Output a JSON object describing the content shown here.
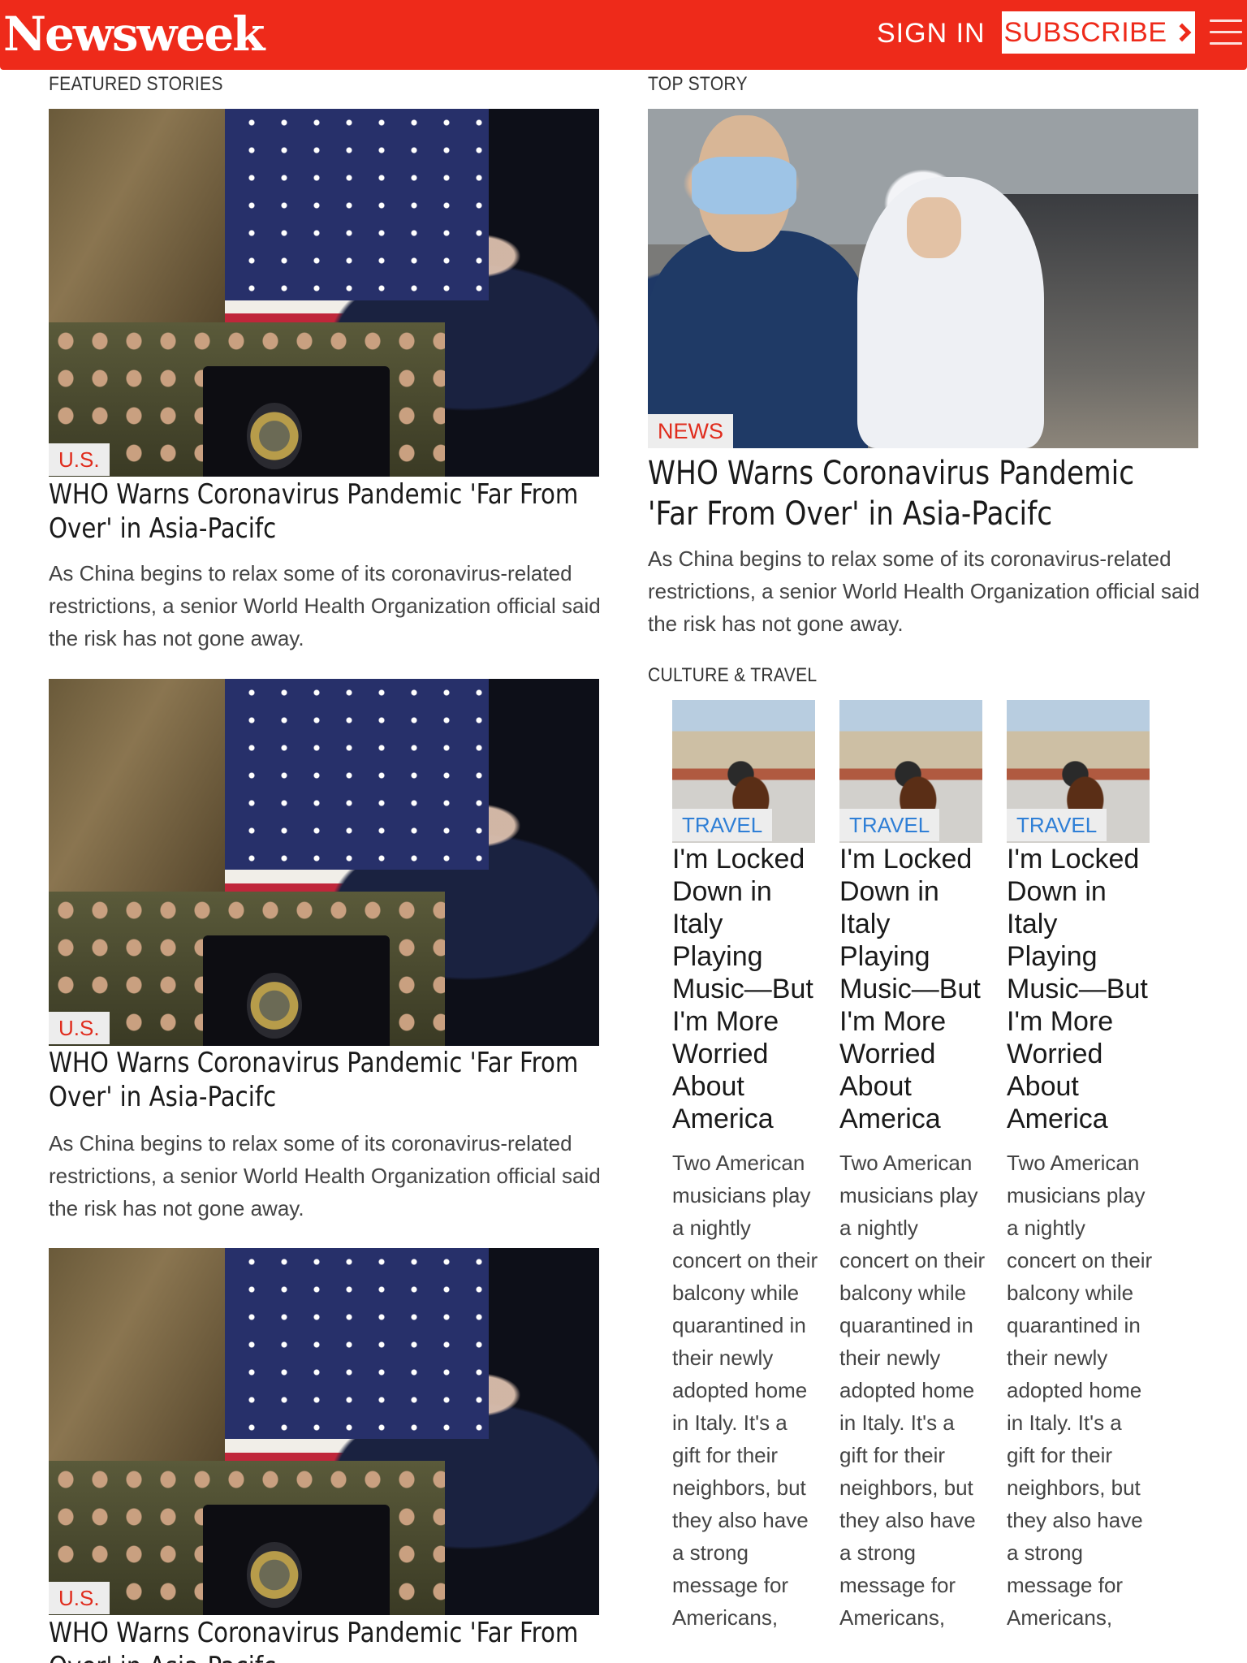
{
  "header": {
    "logo": "Newsweek",
    "signin_label": "SIGN IN",
    "subscribe_label": "SUBSCRIBE",
    "accent_color": "#ee2a1a"
  },
  "featured": {
    "section_label": "FEATURED STORIES",
    "stories": [
      {
        "tag": "U.S.",
        "headline": "WHO Warns Coronavirus Pandemic 'Far From Over' in Asia-Pacifc",
        "deck": "As China begins to relax some of its coronavirus-related restrictions, a senior World Health Organization official said the risk has not gone away."
      },
      {
        "tag": "U.S.",
        "headline": "WHO Warns Coronavirus Pandemic 'Far From Over' in Asia-Pacifc",
        "deck": "As China begins to relax some of its coronavirus-related restrictions, a senior World Health Organization official said the risk has not gone away."
      },
      {
        "tag": "U.S.",
        "headline": "WHO Warns Coronavirus Pandemic 'Far From Over' in Asia-Pacifc",
        "deck": ""
      }
    ]
  },
  "top_story": {
    "section_label": "TOP STORY",
    "tag": "NEWS",
    "headline": "WHO Warns Coronavirus Pandemic 'Far From Over' in Asia-Pacifc",
    "deck": "As China begins to relax some of its coronavirus-related restrictions, a senior World Health Organization official said the risk has not gone away."
  },
  "culture": {
    "section_label": "CULTURE & TRAVEL",
    "cards": [
      {
        "tag": "TRAVEL",
        "headline": "I'm Locked Down in Italy Playing Music—But I'm More Worried About America",
        "deck": "Two American musicians play a nightly concert on their balcony while quarantined in their newly adopted home in Italy. It's a gift for their neighbors, but they also have a strong message for Americans,"
      },
      {
        "tag": "TRAVEL",
        "headline": "I'm Locked Down in Italy Playing Music—But I'm More Worried About America",
        "deck": "Two American musicians play a nightly concert on their balcony while quarantined in their newly adopted home in Italy. It's a gift for their neighbors, but they also have a strong message for Americans,"
      },
      {
        "tag": "TRAVEL",
        "headline": "I'm Locked Down in Italy Playing Music—But I'm More Worried About America",
        "deck": "Two American musicians play a nightly concert on their balcony while quarantined in their newly adopted home in Italy. It's a gift for their neighbors, but they also have a strong message for Americans,"
      }
    ]
  }
}
